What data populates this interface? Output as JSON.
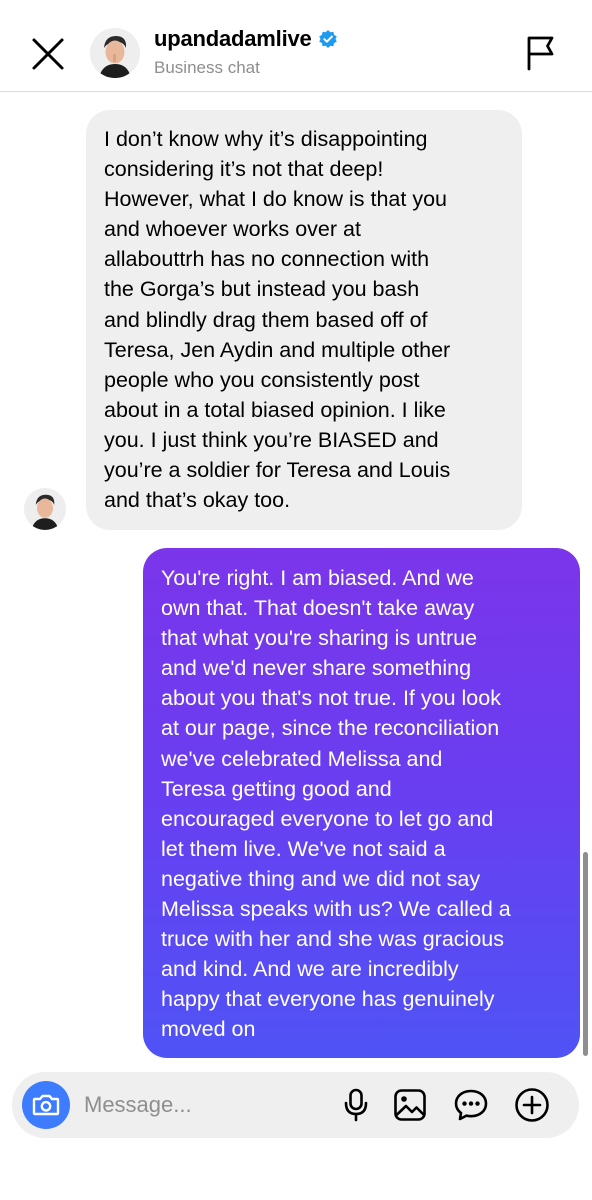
{
  "header": {
    "username": "upandadamlive",
    "subtitle": "Business chat",
    "close_icon": "close-icon",
    "report_icon": "flag-icon",
    "verified_icon": "verified-badge-icon"
  },
  "messages": [
    {
      "direction": "incoming",
      "text": "I don’t know why it’s disappointing\nconsidering it’s not that deep!\nHowever, what I do know is that you\nand whoever works over at\nallabouttrh has no connection with\nthe Gorga’s but instead you bash\nand blindly drag them based off of\nTeresa, Jen Aydin and multiple other\npeople who you consistently post\nabout in a total biased opinion.  I like\nyou.  I just think you’re BIASED and\nyou’re a soldier for Teresa and Louis\nand that’s okay too."
    },
    {
      "direction": "outgoing",
      "text": "You're right. I am biased. And we\nown that. That doesn't take away\nthat what you're sharing is untrue\nand we'd never share something\nabout you that's not true. If you look\nat our page, since the reconciliation\nwe've celebrated Melissa and\nTeresa getting good and\nencouraged everyone to let go and\nlet them live. We've not said a\nnegative thing and we did not say\nMelissa speaks with us? We called a\ntruce with her and she was gracious\nand kind. And we are incredibly\nhappy that everyone has genuinely\nmoved on"
    }
  ],
  "composer": {
    "placeholder": "Message...",
    "icons": [
      "camera-icon",
      "microphone-icon",
      "image-icon",
      "sticker-chat-icon",
      "plus-icon"
    ]
  },
  "colors": {
    "incoming_bubble": "#efefef",
    "outgoing_gradient_top": "#7b35ea",
    "outgoing_gradient_bottom": "#4f53f5",
    "camera_button": "#3d7bff",
    "verified": "#1d9bf0"
  }
}
